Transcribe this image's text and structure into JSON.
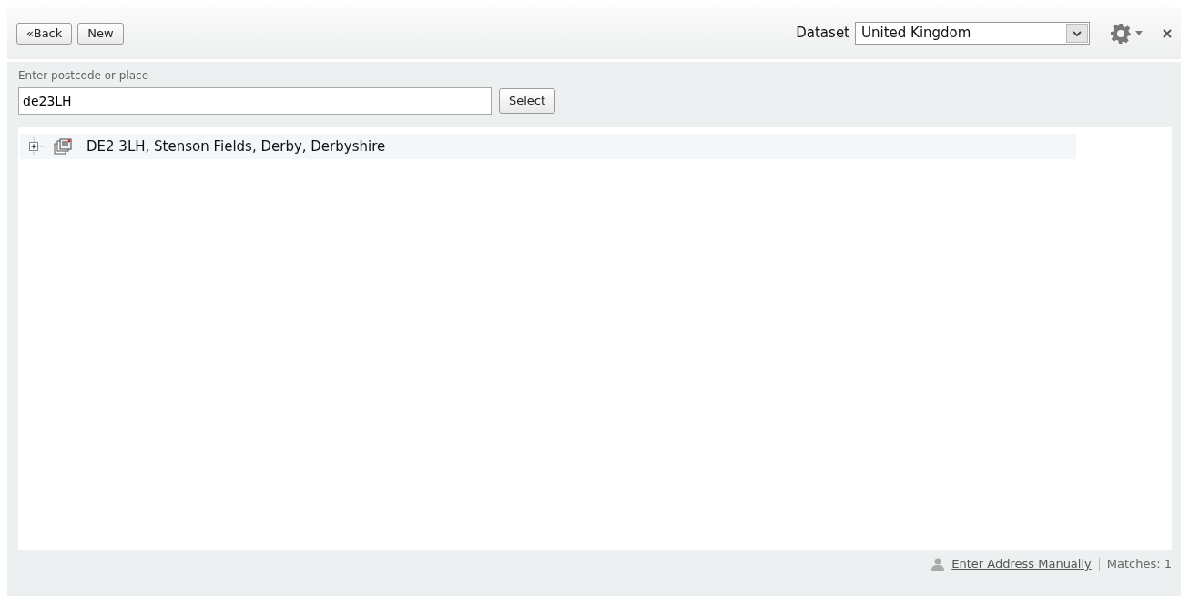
{
  "toolbar": {
    "buttons": [
      "«Back",
      "New"
    ],
    "dataset_label": "Dataset",
    "dataset": {
      "value": "United Kingdom"
    }
  },
  "search": {
    "label": "Enter postcode or place",
    "value": "de23LH",
    "button": "Select"
  },
  "results": [
    {
      "text": "DE2 3LH, Stenson Fields, Derby, Derbyshire",
      "expanded": false,
      "selected": true
    }
  ],
  "status_bar": {
    "link": "Enter Address Manually",
    "matches": "Matches: 1"
  }
}
